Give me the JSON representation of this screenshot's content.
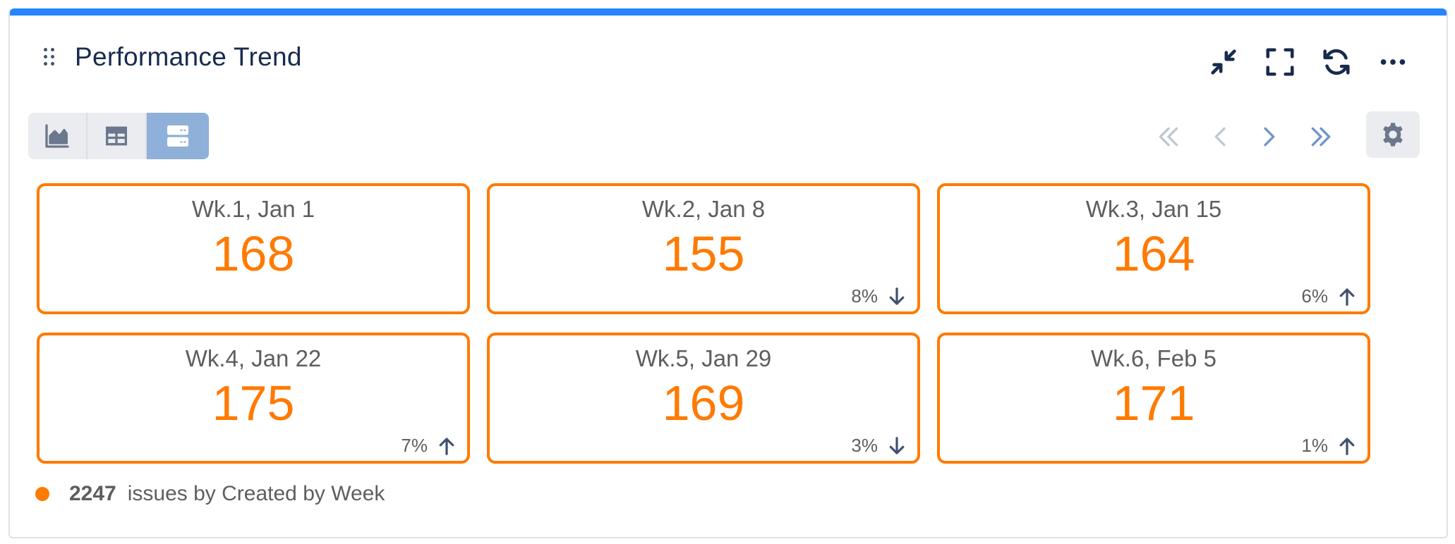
{
  "header": {
    "title": "Performance Trend",
    "actions": [
      {
        "name": "minimize-icon"
      },
      {
        "name": "fullscreen-icon"
      },
      {
        "name": "refresh-icon"
      },
      {
        "name": "more-icon"
      }
    ]
  },
  "toolbar": {
    "views": [
      {
        "name": "chart-view-icon",
        "active": false
      },
      {
        "name": "table-view-icon",
        "active": false
      },
      {
        "name": "cards-view-icon",
        "active": true
      }
    ],
    "pager": [
      "first-page-icon",
      "previous-page-icon",
      "next-page-icon",
      "last-page-icon"
    ],
    "settings_icon": "gear-icon"
  },
  "cards": [
    {
      "label": "Wk.1, Jan 1",
      "value": "168",
      "change": "",
      "direction": ""
    },
    {
      "label": "Wk.2, Jan 8",
      "value": "155",
      "change": "8%",
      "direction": "down"
    },
    {
      "label": "Wk.3, Jan 15",
      "value": "164",
      "change": "6%",
      "direction": "up"
    },
    {
      "label": "Wk.4, Jan 22",
      "value": "175",
      "change": "7%",
      "direction": "up"
    },
    {
      "label": "Wk.5, Jan 29",
      "value": "169",
      "change": "3%",
      "direction": "down"
    },
    {
      "label": "Wk.6, Feb 5",
      "value": "171",
      "change": "1%",
      "direction": "up"
    }
  ],
  "footer": {
    "count": "2247",
    "description": "issues by Created by Week"
  },
  "colors": {
    "accent": "#ff7a00",
    "topbar": "#2684ff",
    "title": "#172b4d",
    "active_view": "#8fb0d9"
  }
}
